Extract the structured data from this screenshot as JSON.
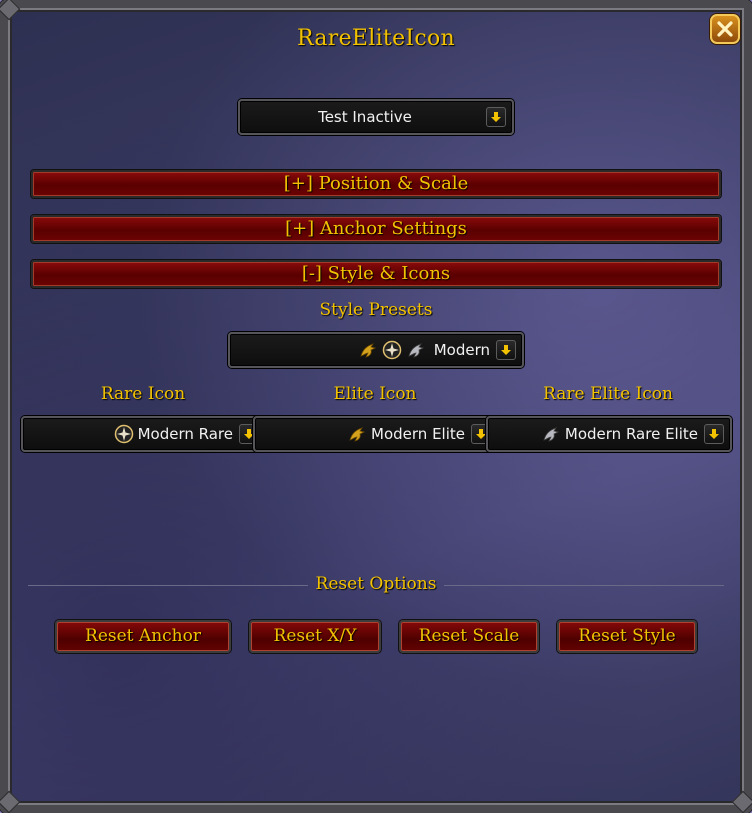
{
  "window": {
    "title": "RareEliteIcon"
  },
  "test_dropdown": {
    "value": "Test Inactive"
  },
  "sections": {
    "position_scale": "[+] Position & Scale",
    "anchor_settings": "[+] Anchor Settings",
    "style_icons": "[-] Style & Icons"
  },
  "style_presets": {
    "label": "Style Presets",
    "value": "Modern",
    "icons": [
      "dragon-gold-icon",
      "compass-star-icon",
      "dragon-silver-icon"
    ]
  },
  "rare_icon": {
    "label": "Rare Icon",
    "value": "Modern Rare",
    "icon": "compass-star-icon"
  },
  "elite_icon": {
    "label": "Elite Icon",
    "value": "Modern Elite",
    "icon": "dragon-gold-icon"
  },
  "rare_elite_icon": {
    "label": "Rare Elite Icon",
    "value": "Modern Rare Elite",
    "icon": "dragon-silver-icon"
  },
  "reset": {
    "label": "Reset Options",
    "anchor": "Reset Anchor",
    "xy": "Reset X/Y",
    "scale": "Reset Scale",
    "style": "Reset Style"
  },
  "colors": {
    "gold_text": "#f2c200",
    "button_red": "#6d0303",
    "panel_bg": "#3b3c63"
  }
}
